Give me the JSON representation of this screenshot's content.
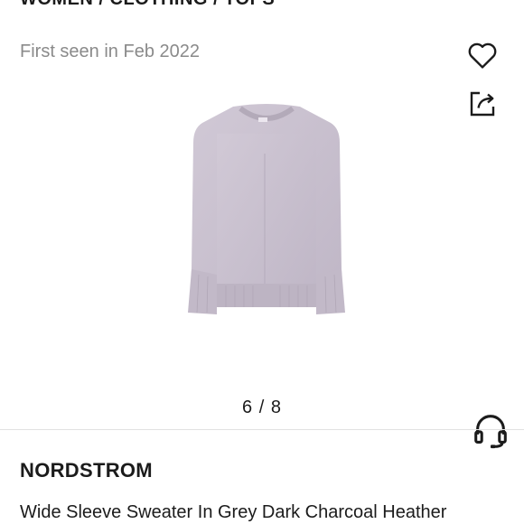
{
  "breadcrumb": "WOMEN / CLOTHING / TOPS",
  "first_seen": "First seen in Feb 2022",
  "icons": {
    "favorite": "heart-icon",
    "share": "share-icon",
    "support": "headset-icon"
  },
  "image": {
    "description": "sweater-image",
    "color": "#c8bfcd"
  },
  "gallery": {
    "counter": "6 / 8"
  },
  "product": {
    "brand": "NORDSTROM",
    "title": "Wide Sleeve Sweater In Grey Dark Charcoal Heather"
  }
}
